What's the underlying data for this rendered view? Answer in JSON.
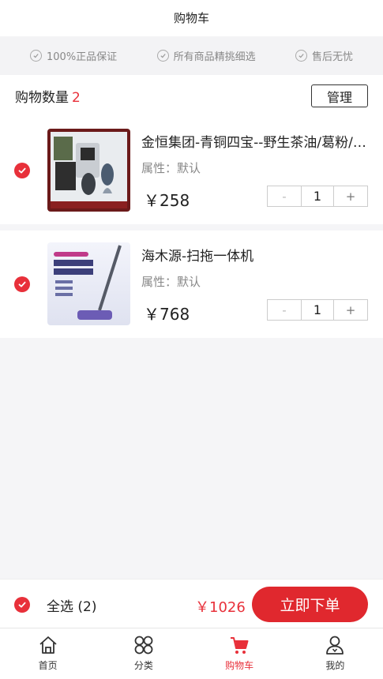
{
  "header": {
    "title": "购物车"
  },
  "guarantees": [
    {
      "icon": "check-circle-icon",
      "label": "100%正品保证"
    },
    {
      "icon": "check-circle-icon",
      "label": "所有商品精挑细选"
    },
    {
      "icon": "check-circle-icon",
      "label": "售后无忧"
    }
  ],
  "summary": {
    "label": "购物数量",
    "count": "2",
    "manage_label": "管理"
  },
  "items": [
    {
      "title": "金恒集团-青铜四宝--野生茶油/葛粉/蜂蜜/…",
      "attr": "属性：默认",
      "price": "￥258",
      "quantity": "1",
      "minus": "-",
      "plus": "+",
      "checked": true
    },
    {
      "title": "海木源-扫拖一体机",
      "attr": "属性：默认",
      "price": "￥768",
      "quantity": "1",
      "minus": "-",
      "plus": "+",
      "checked": true
    }
  ],
  "footer": {
    "select_all": "全选 (2)",
    "total": "￥1026",
    "order_label": "立即下单"
  },
  "tabbar": [
    {
      "label": "首页",
      "icon": "home-icon",
      "active": false
    },
    {
      "label": "分类",
      "icon": "category-icon",
      "active": false
    },
    {
      "label": "购物车",
      "icon": "cart-icon",
      "active": true
    },
    {
      "label": "我的",
      "icon": "user-icon",
      "active": false
    }
  ],
  "colors": {
    "accent": "#e8303a",
    "button": "#e0282e"
  }
}
